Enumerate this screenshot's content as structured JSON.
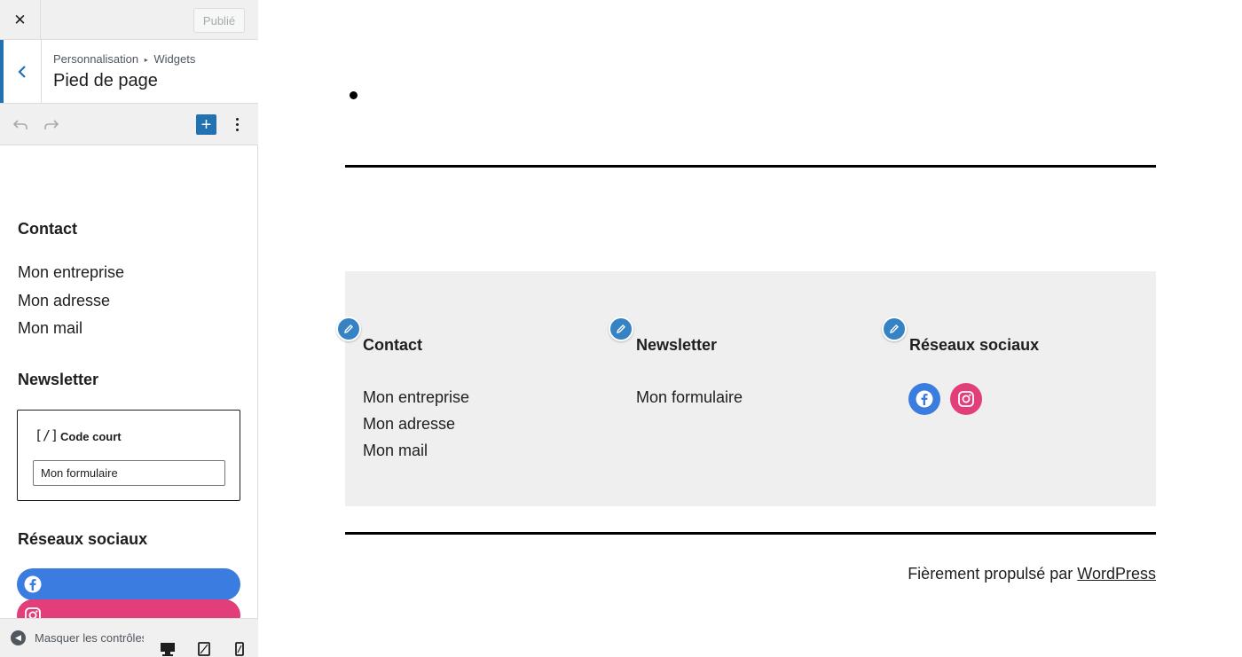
{
  "topbar": {
    "close_symbol": "✕",
    "publish_label": "Publié"
  },
  "section": {
    "breadcrumb_root": "Personnalisation",
    "breadcrumb_sep": "▸",
    "breadcrumb_current": "Widgets",
    "title": "Pied de page"
  },
  "toolbar": {
    "add_symbol": "+"
  },
  "sidebar": {
    "contact": {
      "heading": "Contact",
      "lines": [
        "Mon entreprise",
        "Mon adresse",
        "Mon mail"
      ]
    },
    "newsletter": {
      "heading": "Newsletter",
      "shortcode_icon": "[/]",
      "shortcode_label": "Code court",
      "shortcode_value": "Mon formulaire"
    },
    "social": {
      "heading": "Réseaux sociaux"
    }
  },
  "bottombar": {
    "hide_label": "Masquer les contrôles"
  },
  "preview": {
    "columns": [
      {
        "title": "Contact",
        "lines": [
          "Mon entreprise",
          "Mon adresse",
          "Mon mail"
        ]
      },
      {
        "title": "Newsletter",
        "lines": [
          "Mon formulaire"
        ]
      },
      {
        "title": "Réseaux sociaux",
        "lines": []
      }
    ],
    "credit_text": "Fièrement propulsé par",
    "credit_link": "WordPress"
  },
  "colors": {
    "accent": "#2271b1",
    "pencil": "#3582c4",
    "facebook": "#3b7ce0",
    "instagram": "#e23f7a",
    "footer_bg": "#efefef"
  }
}
